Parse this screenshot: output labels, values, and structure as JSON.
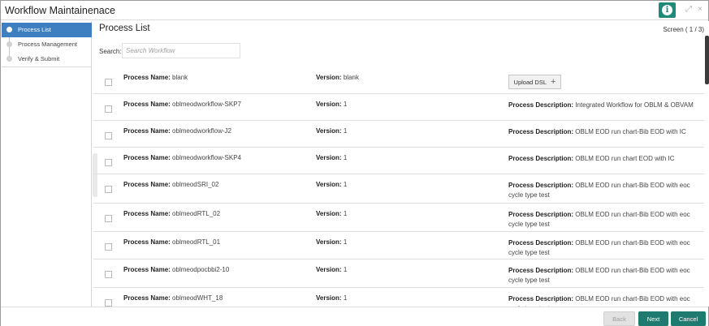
{
  "window": {
    "title": "Workflow Maintainenace",
    "info_icon": "info-icon",
    "minimize_glyph": "⤢",
    "close_glyph": "×"
  },
  "sidebar": {
    "items": [
      {
        "label": "Process List",
        "active": true
      },
      {
        "label": "Process Management",
        "active": false
      },
      {
        "label": "Verify & Submit",
        "active": false
      }
    ]
  },
  "main": {
    "section_title": "Process List",
    "screen_indicator": "Screen ( 1 / 3)",
    "search": {
      "label": "Search:",
      "placeholder": "Search Workflow",
      "value": ""
    },
    "labels": {
      "name": "Process Name:",
      "version": "Version:",
      "description": "Process Description:"
    },
    "upload_button": "Upload DSL",
    "rows": [
      {
        "name": "blank",
        "version": "blank",
        "description": null,
        "upload": true
      },
      {
        "name": "oblmeodworkflow-SKP7",
        "version": "1",
        "description": "Integrated Workflow for OBLM & OBVAM"
      },
      {
        "name": "oblmeodworkflow-J2",
        "version": "1",
        "description": "OBLM EOD run chart-Bib EOD with IC"
      },
      {
        "name": "oblmeodworkflow-SKP4",
        "version": "1",
        "description": "OBLM EOD run chart EOD with IC"
      },
      {
        "name": "oblmeodSRI_02",
        "version": "1",
        "description": "OBLM EOD run chart-Bib EOD with eoc cycle type test"
      },
      {
        "name": "oblmeodRTL_02",
        "version": "1",
        "description": "OBLM EOD run chart-Bib EOD with eoc cycle type test"
      },
      {
        "name": "oblmeodRTL_01",
        "version": "1",
        "description": "OBLM EOD run chart-Bib EOD with eoc cycle type test"
      },
      {
        "name": "oblmeodpocbbi2-10",
        "version": "1",
        "description": "OBLM EOD run chart-Bib EOD with eoc cycle type test"
      },
      {
        "name": "oblmeodWHT_18",
        "version": "1",
        "description": "OBLM EOD run chart-Bib EOD with eoc cycle type test"
      }
    ]
  },
  "footer": {
    "back": "Back",
    "next": "Next",
    "cancel": "Cancel"
  },
  "colors": {
    "accent": "#1f7a6f",
    "active_step": "#3e7fc1"
  }
}
